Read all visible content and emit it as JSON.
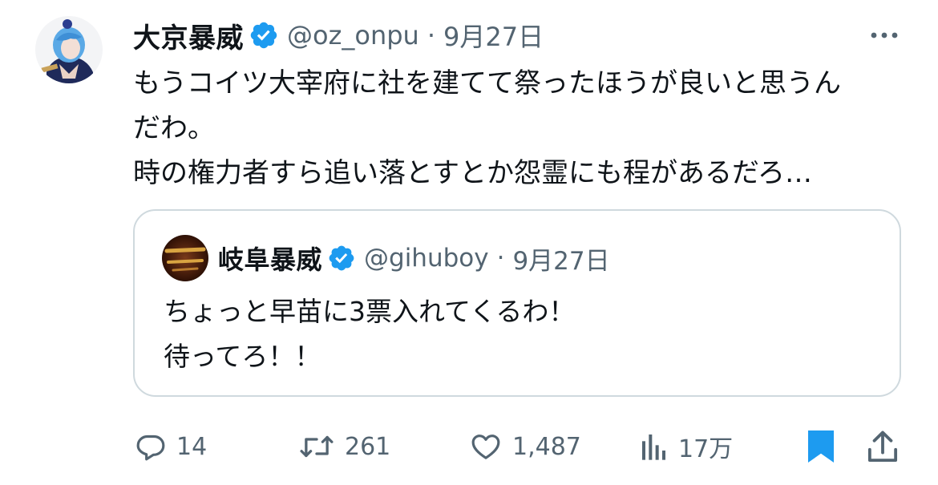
{
  "tweet": {
    "author": {
      "display_name": "大京暴威",
      "handle": "@oz_onpu",
      "verified": true
    },
    "separator": "·",
    "date": "9月27日",
    "text_lines": [
      "もうコイツ大宰府に社を建てて祭ったほうが良いと思うん",
      "だわ。",
      "時の権力者すら追い落とすとか怨霊にも程があるだろ…"
    ]
  },
  "quote": {
    "author": {
      "display_name": "岐阜暴威",
      "handle": "@gihuboy",
      "verified": true
    },
    "separator": "·",
    "date": "9月27日",
    "text_lines": [
      "ちょっと早苗に3票入れてくるわ！",
      "待ってろ！！"
    ]
  },
  "actions": {
    "reply": {
      "icon": "reply-icon",
      "count": "14"
    },
    "retweet": {
      "icon": "retweet-icon",
      "count": "261"
    },
    "like": {
      "icon": "heart-icon",
      "count": "1,487"
    },
    "views": {
      "icon": "views-icon",
      "count": "17万"
    },
    "bookmark": {
      "icon": "bookmark-icon",
      "active": true
    },
    "share": {
      "icon": "share-icon"
    }
  },
  "colors": {
    "text_primary": "#0f1419",
    "text_secondary": "#536471",
    "verified_blue": "#1d9bf0",
    "border": "#cfd9de",
    "bookmark_active": "#1d9bf0"
  }
}
